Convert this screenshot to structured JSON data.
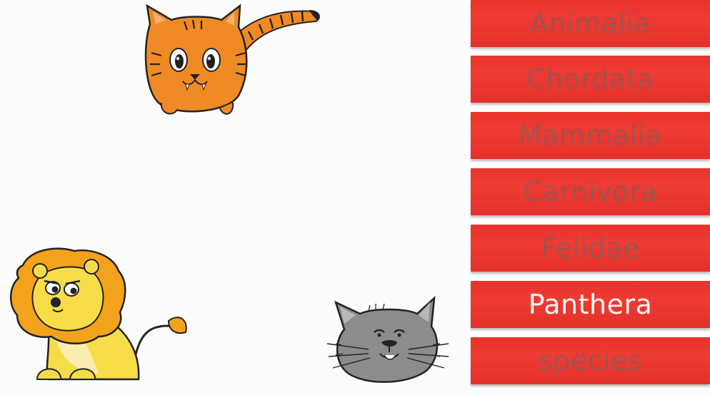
{
  "taxonomy": {
    "ranks": [
      {
        "label": "Animalia",
        "active": false
      },
      {
        "label": "Chordata",
        "active": false
      },
      {
        "label": "Mammalia",
        "active": false
      },
      {
        "label": "Carnivora",
        "active": false
      },
      {
        "label": "Felidae",
        "active": false
      },
      {
        "label": "Panthera",
        "active": true
      },
      {
        "label": "species",
        "active": false
      }
    ]
  },
  "animals": {
    "tiger": "tiger-cartoon",
    "lion": "lion-cartoon",
    "cat": "cat-cartoon"
  },
  "colors": {
    "rank_background": "#e8332c",
    "rank_text_inactive": "#8a5a56",
    "rank_text_active": "#fff6f2",
    "tiger_orange": "#f08a24",
    "lion_mane": "#f3a21c",
    "lion_body": "#f7dc4a",
    "cat_gray": "#8c8c8c"
  }
}
